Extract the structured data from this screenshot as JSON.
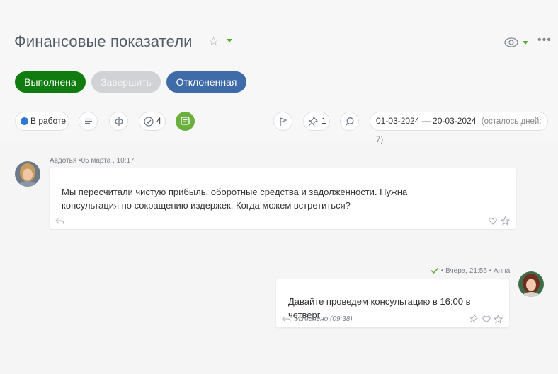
{
  "header": {
    "title": "Финансовые показатели",
    "accent_color": "#59a830"
  },
  "actions": {
    "done_label": "Выполнена",
    "finish_label": "Завершить",
    "reject_label": "Отклоненная"
  },
  "toolbar": {
    "status_label": "В работе",
    "status_color": "#2f79d4",
    "checklist_count": "4",
    "pin_count": "1",
    "dates_range": "01-03-2024 — 20-03-2024",
    "dates_left": "(осталось дней: 7)"
  },
  "messages": [
    {
      "author": "Авдотья",
      "time": "05 марта , 10:17",
      "text_line1": "Мы пересчитали чистую прибыль, оборотные средства и задолженности. Нужна",
      "text_line2": "консультация по сокращению издержек. Когда можем встретиться?"
    },
    {
      "author": "Анна",
      "time": "Вчера, 21:55",
      "text": "Давайте проведем консультацию в 16:00 в четверг",
      "edited": "Изменено (09:38)"
    }
  ]
}
